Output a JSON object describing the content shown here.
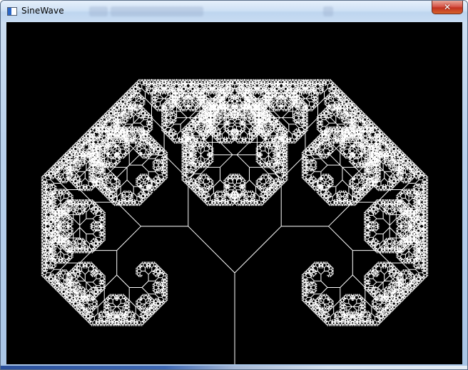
{
  "window": {
    "title": "SineWave",
    "close_symbol": "✕"
  },
  "icons": {
    "app": "app-window-icon",
    "close": "close-icon"
  },
  "colors": {
    "canvas_background": "#000000",
    "fractal_stroke": "#ffffff",
    "close_button": "#c9412f"
  }
}
